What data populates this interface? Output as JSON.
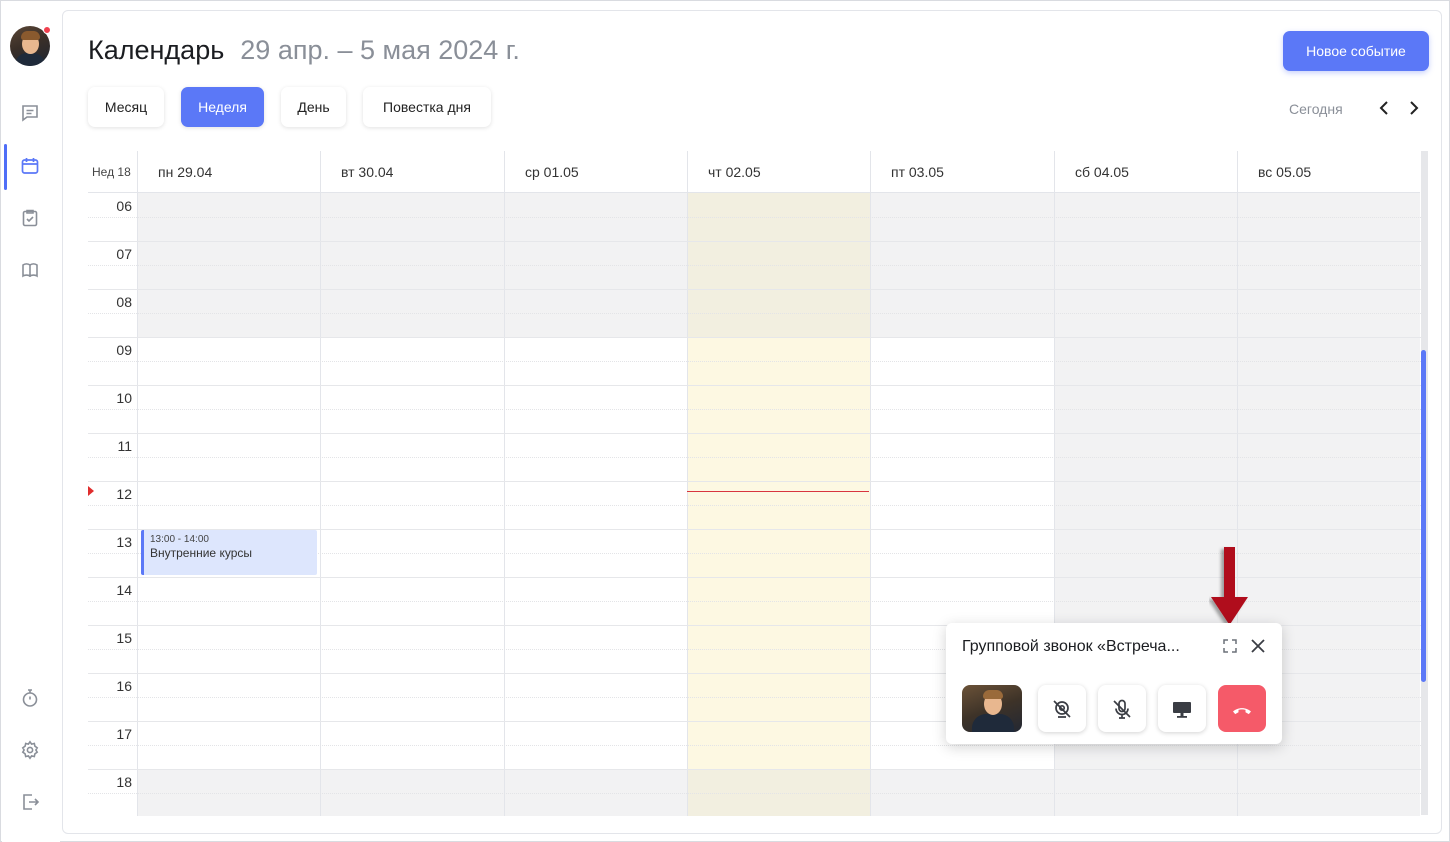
{
  "header": {
    "title": "Календарь",
    "range": "29 апр. – 5 мая 2024 г.",
    "new_event": "Новое событие",
    "today": "Сегодня"
  },
  "views": [
    {
      "label": "Месяц",
      "active": false
    },
    {
      "label": "Неделя",
      "active": true
    },
    {
      "label": "День",
      "active": false
    },
    {
      "label": "Повестка дня",
      "active": false
    }
  ],
  "week_label": "Нед 18",
  "days": [
    {
      "label": "пн 29.04"
    },
    {
      "label": "вт 30.04"
    },
    {
      "label": "ср 01.05"
    },
    {
      "label": "чт 02.05"
    },
    {
      "label": "пт 03.05"
    },
    {
      "label": "сб 04.05"
    },
    {
      "label": "вс 05.05"
    }
  ],
  "hours": [
    "06",
    "07",
    "08",
    "09",
    "10",
    "11",
    "12",
    "13",
    "14",
    "15",
    "16",
    "17",
    "18"
  ],
  "event": {
    "time": "13:00 - 14:00",
    "title": "Внутренние курсы"
  },
  "call": {
    "title": "Групповой звонок «Встреча..."
  },
  "colors": {
    "accent": "#5b78f7",
    "today_col": "#fdf8e2",
    "offhours": "#f2f2f3",
    "hangup": "#f55a69",
    "now": "#d8353e"
  }
}
